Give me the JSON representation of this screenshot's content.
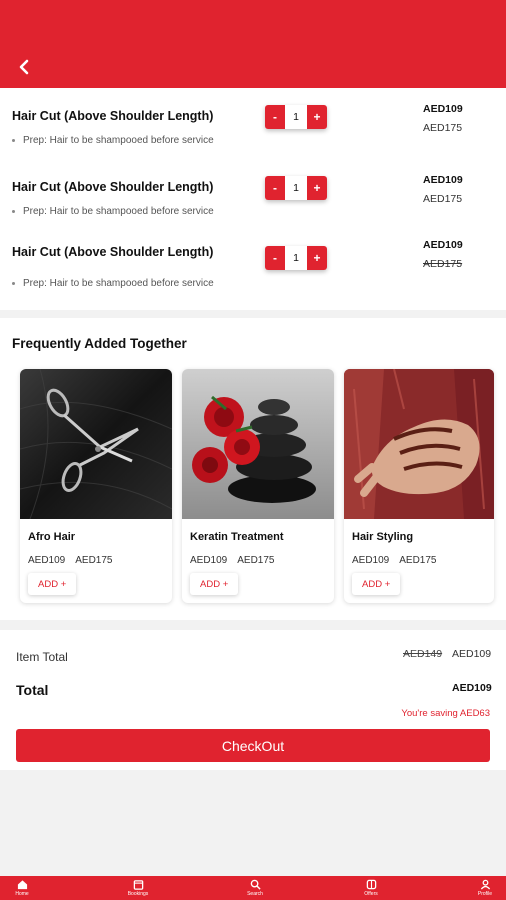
{
  "header": {
    "back_icon": "chevron-left-icon",
    "color": "#e0232f"
  },
  "cart": {
    "items": [
      {
        "name": "Hair Cut (Above Shoulder Length)",
        "prep": "Prep: Hair to be shampooed before service",
        "qty": "1",
        "price": "AED109",
        "old_price": "AED175",
        "old_struck": false
      },
      {
        "name": "Hair Cut (Above Shoulder Length)",
        "prep": "Prep: Hair to be shampooed before service",
        "qty": "1",
        "price": "AED109",
        "old_price": "AED175",
        "old_struck": false
      },
      {
        "name": "Hair Cut (Above Shoulder Length)",
        "prep": "Prep: Hair to be shampooed before service",
        "qty": "1",
        "price": "AED109",
        "old_price": "AED175",
        "old_struck": true
      }
    ],
    "minus_label": "-",
    "plus_label": "+"
  },
  "frequently_added": {
    "title": "Frequently Added Together",
    "cards": [
      {
        "name": "Afro Hair",
        "price": "AED109",
        "old_price": "AED175",
        "add_label": "ADD +",
        "image": "scissors-on-dark-hair"
      },
      {
        "name": "Keratin Treatment",
        "price": "AED109",
        "old_price": "AED175",
        "add_label": "ADD +",
        "image": "red-roses-on-black-stones"
      },
      {
        "name": "Hair Styling",
        "price": "AED109",
        "old_price": "AED175",
        "add_label": "ADD +",
        "image": "henna-hand"
      }
    ]
  },
  "summary": {
    "item_total_label": "Item Total",
    "item_total_old": "AED149",
    "item_total_new": "AED109",
    "total_label": "Total",
    "total_value": "AED109",
    "saving_text": "You're saving AED63",
    "checkout_label": "CheckOut"
  },
  "tabbar": {
    "tabs": [
      {
        "label": "Home",
        "icon": "home-icon"
      },
      {
        "label": "Bookings",
        "icon": "calendar-icon"
      },
      {
        "label": "Search",
        "icon": "search-icon"
      },
      {
        "label": "Offers",
        "icon": "offers-icon"
      },
      {
        "label": "Profile",
        "icon": "profile-icon"
      }
    ]
  }
}
